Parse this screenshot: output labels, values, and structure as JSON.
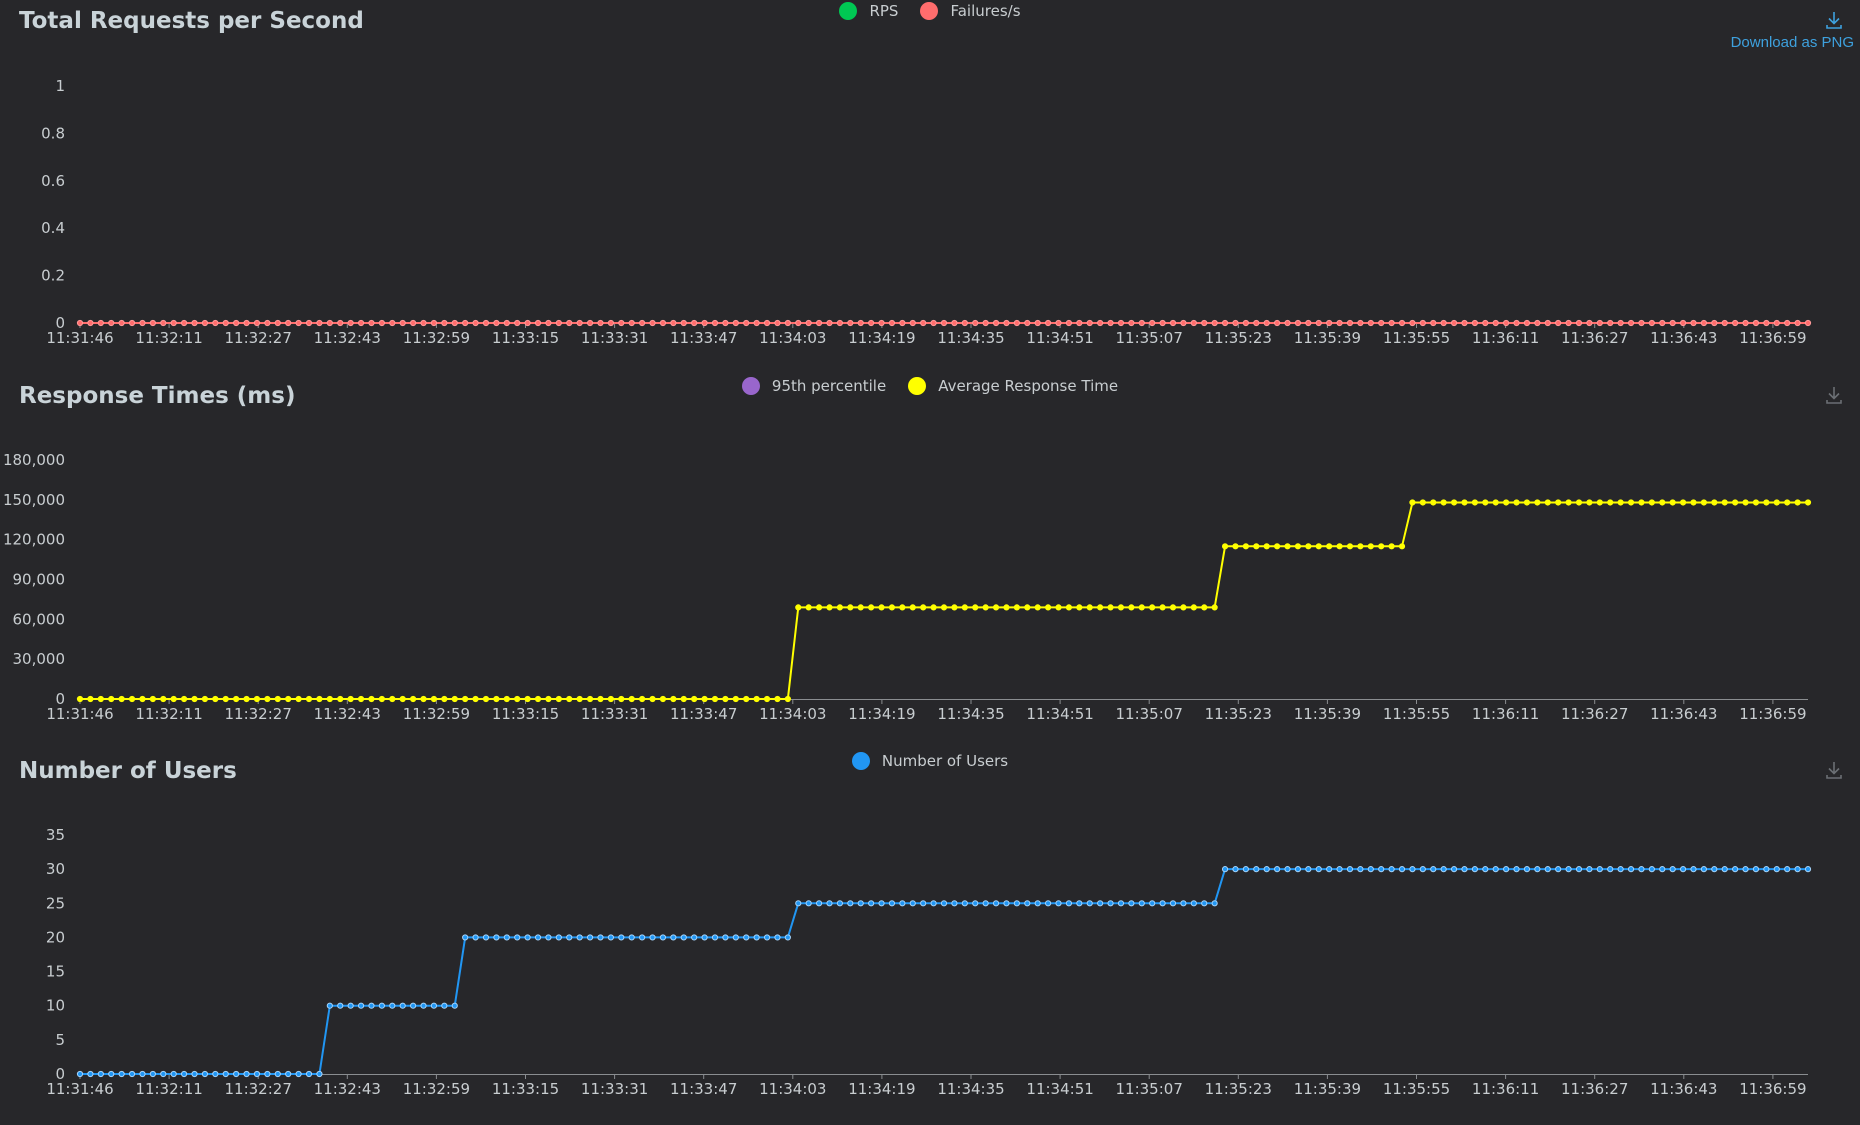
{
  "download_label": "Download as PNG",
  "chart_data": [
    {
      "type": "line",
      "title": "Total Requests per Second",
      "categories": [
        "11:31:46",
        "11:32:11",
        "11:32:27",
        "11:32:43",
        "11:32:59",
        "11:33:15",
        "11:33:31",
        "11:33:47",
        "11:34:03",
        "11:34:19",
        "11:34:35",
        "11:34:51",
        "11:35:07",
        "11:35:23",
        "11:35:39",
        "11:35:55",
        "11:36:11",
        "11:36:27",
        "11:36:43",
        "11:36:59"
      ],
      "yticks": [
        "0",
        "0.2",
        "0.4",
        "0.6",
        "0.8",
        "1"
      ],
      "ylim": [
        0,
        1
      ],
      "grid": false,
      "legend_position": "top-center",
      "series": [
        {
          "name": "RPS",
          "color": "#00c853",
          "values": "all 0 (hidden beneath Failures/s)"
        },
        {
          "name": "Failures/s",
          "color": "#ff6d6d",
          "values": "all 0"
        }
      ],
      "segments": [
        {
          "value": 0,
          "points": 167
        }
      ]
    },
    {
      "type": "line",
      "title": "Response Times (ms)",
      "categories": [
        "11:31:46",
        "11:32:11",
        "11:32:27",
        "11:32:43",
        "11:32:59",
        "11:33:15",
        "11:33:31",
        "11:33:47",
        "11:34:03",
        "11:34:19",
        "11:34:35",
        "11:34:51",
        "11:35:07",
        "11:35:23",
        "11:35:39",
        "11:35:55",
        "11:36:11",
        "11:36:27",
        "11:36:43",
        "11:36:59"
      ],
      "yticks": [
        "0",
        "30,000",
        "60,000",
        "90,000",
        "120,000",
        "150,000",
        "180,000"
      ],
      "ylim": [
        0,
        180000
      ],
      "grid": false,
      "legend_position": "top-center",
      "series": [
        {
          "name": "95th percentile",
          "color": "#9966cc",
          "values": "not drawn"
        },
        {
          "name": "Average Response Time",
          "color": "#ffff00",
          "values": "step series"
        }
      ],
      "segments": [
        {
          "value": 0,
          "points": 69
        },
        {
          "value": 69000,
          "points": 41
        },
        {
          "value": 115000,
          "points": 18
        },
        {
          "value": 148000,
          "points": 39
        }
      ]
    },
    {
      "type": "line",
      "title": "Number of Users",
      "categories": [
        "11:31:46",
        "11:32:11",
        "11:32:27",
        "11:32:43",
        "11:32:59",
        "11:33:15",
        "11:33:31",
        "11:33:47",
        "11:34:03",
        "11:34:19",
        "11:34:35",
        "11:34:51",
        "11:35:07",
        "11:35:23",
        "11:35:39",
        "11:35:55",
        "11:36:11",
        "11:36:27",
        "11:36:43",
        "11:36:59"
      ],
      "yticks": [
        "0",
        "5",
        "10",
        "15",
        "20",
        "25",
        "30",
        "35"
      ],
      "ylim": [
        0,
        35
      ],
      "grid": false,
      "legend_position": "top-center",
      "series": [
        {
          "name": "Number of Users",
          "color": "#2196f3",
          "values": "step series"
        }
      ],
      "segments": [
        {
          "value": 0,
          "points": 24
        },
        {
          "value": 10,
          "points": 13
        },
        {
          "value": 20,
          "points": 32
        },
        {
          "value": 25,
          "points": 41
        },
        {
          "value": 30,
          "points": 57
        }
      ]
    }
  ]
}
